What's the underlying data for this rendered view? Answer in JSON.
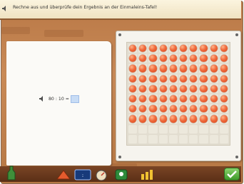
{
  "header": {
    "instruction": "Rechne aus und überprüfe dein Ergebnis an der Einmaleins-Tafel!",
    "speaker_icon": "speaker-icon"
  },
  "exercise": {
    "question": "80 : 10 =",
    "answer_value": "",
    "speaker_icon": "speaker-icon"
  },
  "multiplication_board": {
    "rows": 10,
    "columns": 10,
    "filled_rows": 8,
    "dot_color": "#f06a3c"
  },
  "toolbar": {
    "icons": [
      "bottle-icon",
      "hat-icon",
      "clock-icon",
      "meter-icon",
      "character-icon",
      "bar-chart-icon"
    ],
    "confirm_icon": "checkmark-icon"
  }
}
